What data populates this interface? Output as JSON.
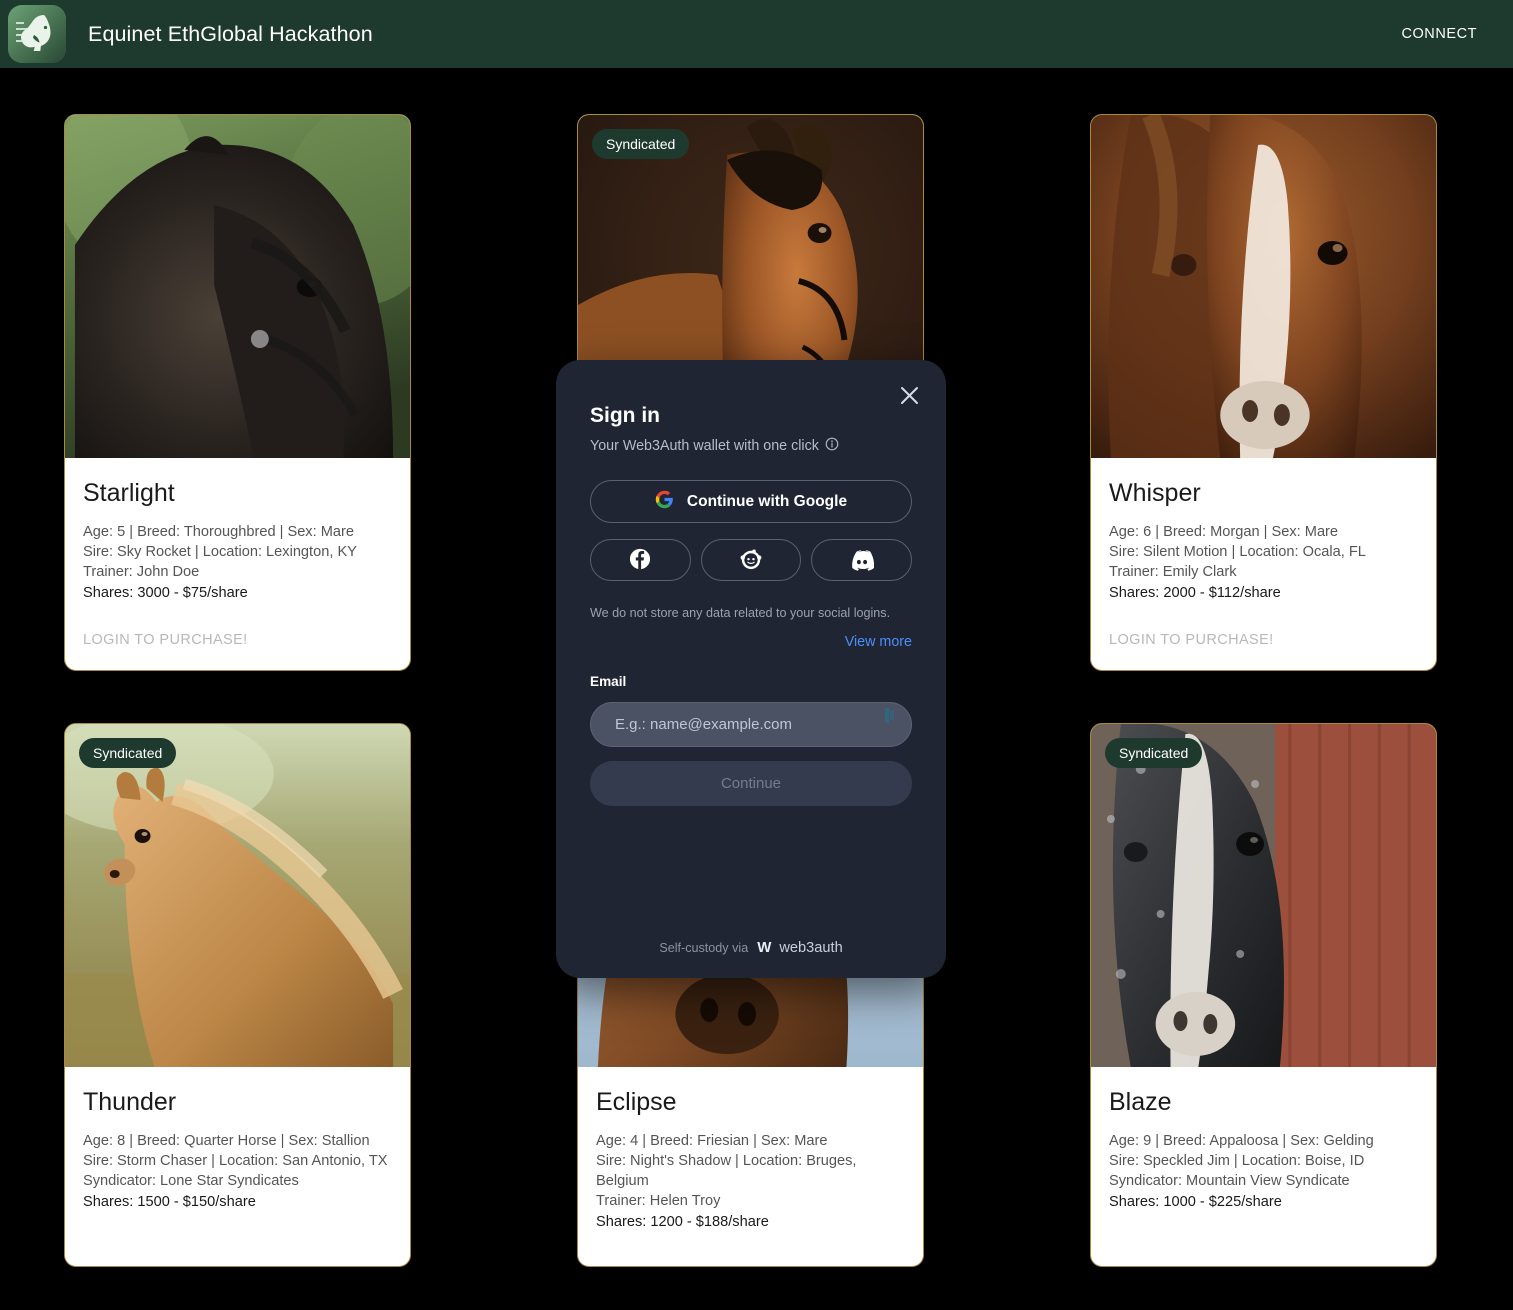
{
  "header": {
    "title": "Equinet EthGlobal Hackathon",
    "connect_label": "CONNECT",
    "logo_icon": "horse-head-logo",
    "bar_color": "#1e3a2f"
  },
  "cards": [
    {
      "name": "Starlight",
      "badge": null,
      "line1": "Age: 5 | Breed: Thoroughbred | Sex: Mare",
      "line2": "Sire: Sky Rocket | Location: Lexington, KY",
      "line3": "Trainer: John Doe",
      "shares": "Shares: 3000 - $75/share",
      "cta": "LOGIN TO PURCHASE!"
    },
    {
      "name": "",
      "badge": "Syndicated",
      "line1": "",
      "line2": "",
      "line3": "",
      "shares": "",
      "cta": ""
    },
    {
      "name": "Whisper",
      "badge": null,
      "line1": "Age: 6 | Breed: Morgan | Sex: Mare",
      "line2": "Sire: Silent Motion | Location: Ocala, FL",
      "line3": "Trainer: Emily Clark",
      "shares": "Shares: 2000 - $112/share",
      "cta": "LOGIN TO PURCHASE!"
    },
    {
      "name": "Thunder",
      "badge": "Syndicated",
      "line1": "Age: 8 | Breed: Quarter Horse | Sex: Stallion",
      "line2": "Sire: Storm Chaser | Location: San Antonio, TX",
      "line3": "Syndicator: Lone Star Syndicates",
      "shares": "Shares: 1500 - $150/share",
      "cta": ""
    },
    {
      "name": "Eclipse",
      "badge": null,
      "line1": "Age: 4 | Breed: Friesian | Sex: Mare",
      "line2": "Sire: Night's Shadow | Location: Bruges, Belgium",
      "line3": "Trainer: Helen Troy",
      "shares": "Shares: 1200 - $188/share",
      "cta": ""
    },
    {
      "name": "Blaze",
      "badge": "Syndicated",
      "line1": "Age: 9 | Breed: Appaloosa | Sex: Gelding",
      "line2": "Sire: Speckled Jim | Location: Boise, ID",
      "line3": "Syndicator: Mountain View Syndicate",
      "shares": "Shares: 1000 - $225/share",
      "cta": ""
    }
  ],
  "modal": {
    "title": "Sign in",
    "subtitle": "Your Web3Auth wallet with one click",
    "info_icon": "info-circle-icon",
    "close_icon": "close-icon",
    "google_button": "Continue with Google",
    "google_icon": "google-icon",
    "facebook_icon": "facebook-icon",
    "reddit_icon": "reddit-icon",
    "discord_icon": "discord-icon",
    "disclaimer": "We do not store any data related to your social logins.",
    "view_more": "View more",
    "email_label": "Email",
    "email_value": "",
    "email_placeholder": "E.g.: name@example.com",
    "continue_label": "Continue",
    "footer_text": "Self-custody via",
    "footer_brand": "web3auth",
    "background": "#1f2533",
    "link_color": "#4d8dfb"
  }
}
